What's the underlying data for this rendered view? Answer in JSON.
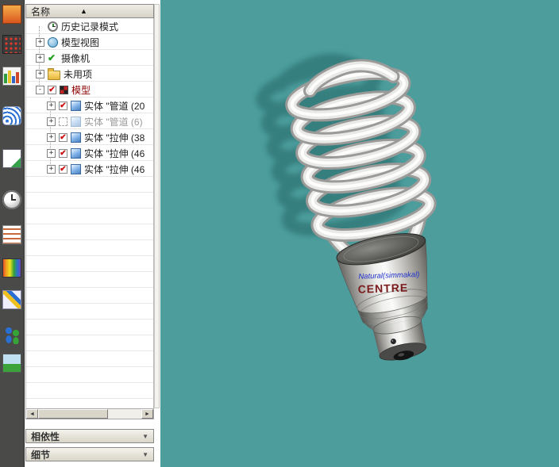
{
  "toolbar": {
    "icons": [
      "layers-icon",
      "snap-grid-icon",
      "chart-icon",
      "signal-icon",
      "document-icon",
      "clock-icon",
      "notes-icon",
      "rainbow-icon",
      "draw-tools-icon",
      "people-icon",
      "image-icon"
    ]
  },
  "tree": {
    "header": {
      "title": "名称",
      "sort_glyph": "▲"
    },
    "items": [
      {
        "expand": "",
        "label": "历史记录模式"
      },
      {
        "expand": "+",
        "label": "模型视图"
      },
      {
        "expand": "+",
        "label": "摄像机"
      },
      {
        "expand": "+",
        "label": "未用项"
      },
      {
        "expand": "-",
        "label": "模型",
        "checked": "✔"
      },
      {
        "expand": "+",
        "label": "实体 \"管道 (20",
        "checked": "✔"
      },
      {
        "expand": "+",
        "label": "实体 \"管道 (6)",
        "checked": ""
      },
      {
        "expand": "+",
        "label": "实体 \"拉伸 (38",
        "checked": "✔"
      },
      {
        "expand": "+",
        "label": "实体 \"拉伸 (46",
        "checked": "✔"
      },
      {
        "expand": "+",
        "label": "实体 \"拉伸 (46",
        "checked": "✔"
      }
    ]
  },
  "hscrollbar": {
    "left_arrow": "◄",
    "right_arrow": "►"
  },
  "bottom_panels": [
    {
      "label": "相依性",
      "chevron": "▼"
    },
    {
      "label": "细节",
      "chevron": "▼"
    }
  ],
  "viewport": {
    "background_color": "#4D9D9D",
    "bulb_text_line1": "Natural(simmakal)",
    "bulb_text_line2": "CENTRE"
  }
}
